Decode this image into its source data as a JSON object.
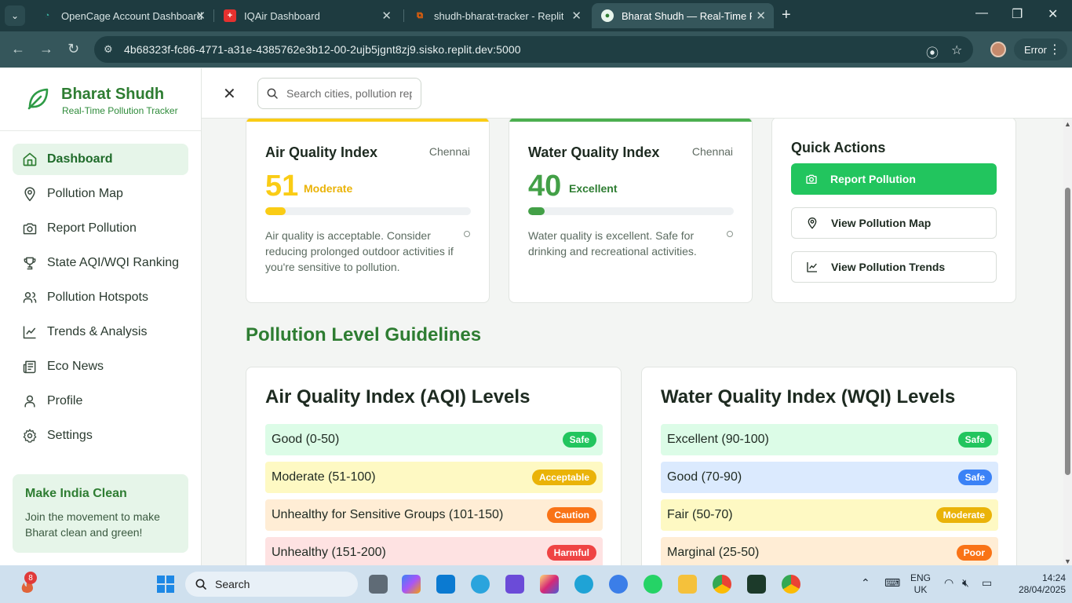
{
  "browser": {
    "tabs": [
      {
        "label": "OpenCage Account Dashboard"
      },
      {
        "label": "IQAir Dashboard"
      },
      {
        "label": "shudh-bharat-tracker - Replit"
      },
      {
        "label": "Bharat Shudh — Real-Time Polli"
      }
    ],
    "active_tab": 3,
    "url": "4b68323f-fc86-4771-a31e-4385762e3b12-00-2ujb5jgnt8zj9.sisko.replit.dev:5000",
    "error_label": "Error"
  },
  "brand": {
    "name": "Bharat Shudh",
    "tagline": "Real-Time Pollution Tracker",
    "color": "#2e7d32"
  },
  "sidebar": {
    "items": [
      {
        "label": "Dashboard",
        "icon": "home-icon",
        "active": true
      },
      {
        "label": "Pollution Map",
        "icon": "map-pin-icon"
      },
      {
        "label": "Report Pollution",
        "icon": "camera-icon"
      },
      {
        "label": "State AQI/WQI Ranking",
        "icon": "trophy-icon"
      },
      {
        "label": "Pollution Hotspots",
        "icon": "users-icon"
      },
      {
        "label": "Trends & Analysis",
        "icon": "chart-line-icon"
      },
      {
        "label": "Eco News",
        "icon": "newspaper-icon"
      },
      {
        "label": "Profile",
        "icon": "user-icon"
      },
      {
        "label": "Settings",
        "icon": "gear-icon"
      }
    ],
    "promo": {
      "title": "Make India Clean",
      "text": "Join the movement to make Bharat clean and green!"
    }
  },
  "search": {
    "placeholder": "Search cities, pollution reports..."
  },
  "aqi_card": {
    "title": "Air Quality Index",
    "city": "Chennai",
    "value": "51",
    "label": "Moderate",
    "progress_fraction": 0.1,
    "description": "Air quality is acceptable. Consider reducing prolonged outdoor activities if you're sensitive to pollution.",
    "accent": "#facc15"
  },
  "wqi_card": {
    "title": "Water Quality Index",
    "city": "Chennai",
    "value": "40",
    "label": "Excellent",
    "progress_fraction": 0.08,
    "description": "Water quality is excellent. Safe for drinking and recreational activities.",
    "accent": "#4caf50"
  },
  "quick_actions": {
    "title": "Quick Actions",
    "buttons": [
      {
        "label": "Report Pollution",
        "icon": "camera-icon"
      },
      {
        "label": "View Pollution Map",
        "icon": "map-pin-icon"
      },
      {
        "label": "View Pollution Trends",
        "icon": "chart-line-icon"
      }
    ]
  },
  "guidelines": {
    "title": "Pollution Level Guidelines",
    "aqi": {
      "title": "Air Quality Index (AQI) Levels",
      "rows": [
        {
          "label": "Good (0-50)",
          "badge": "Safe",
          "bg": "#dcfce7",
          "badge_color": "#22c55e"
        },
        {
          "label": "Moderate (51-100)",
          "badge": "Acceptable",
          "bg": "#fef9c3",
          "badge_color": "#eab308"
        },
        {
          "label": "Unhealthy for Sensitive Groups (101-150)",
          "badge": "Caution",
          "bg": "#ffedd5",
          "badge_color": "#f97316"
        },
        {
          "label": "Unhealthy (151-200)",
          "badge": "Harmful",
          "bg": "#fee2e2",
          "badge_color": "#ef4444"
        }
      ]
    },
    "wqi": {
      "title": "Water Quality Index (WQI) Levels",
      "rows": [
        {
          "label": "Excellent (90-100)",
          "badge": "Safe",
          "bg": "#dcfce7",
          "badge_color": "#22c55e"
        },
        {
          "label": "Good (70-90)",
          "badge": "Safe",
          "bg": "#dbeafe",
          "badge_color": "#3b82f6"
        },
        {
          "label": "Fair (50-70)",
          "badge": "Moderate",
          "bg": "#fef9c3",
          "badge_color": "#eab308"
        },
        {
          "label": "Marginal (25-50)",
          "badge": "Poor",
          "bg": "#ffedd5",
          "badge_color": "#f97316"
        }
      ]
    }
  },
  "taskbar": {
    "search_label": "Search",
    "notification_count": "8",
    "lang_line1": "ENG",
    "lang_line2": "UK",
    "time": "14:24",
    "date": "28/04/2025"
  }
}
